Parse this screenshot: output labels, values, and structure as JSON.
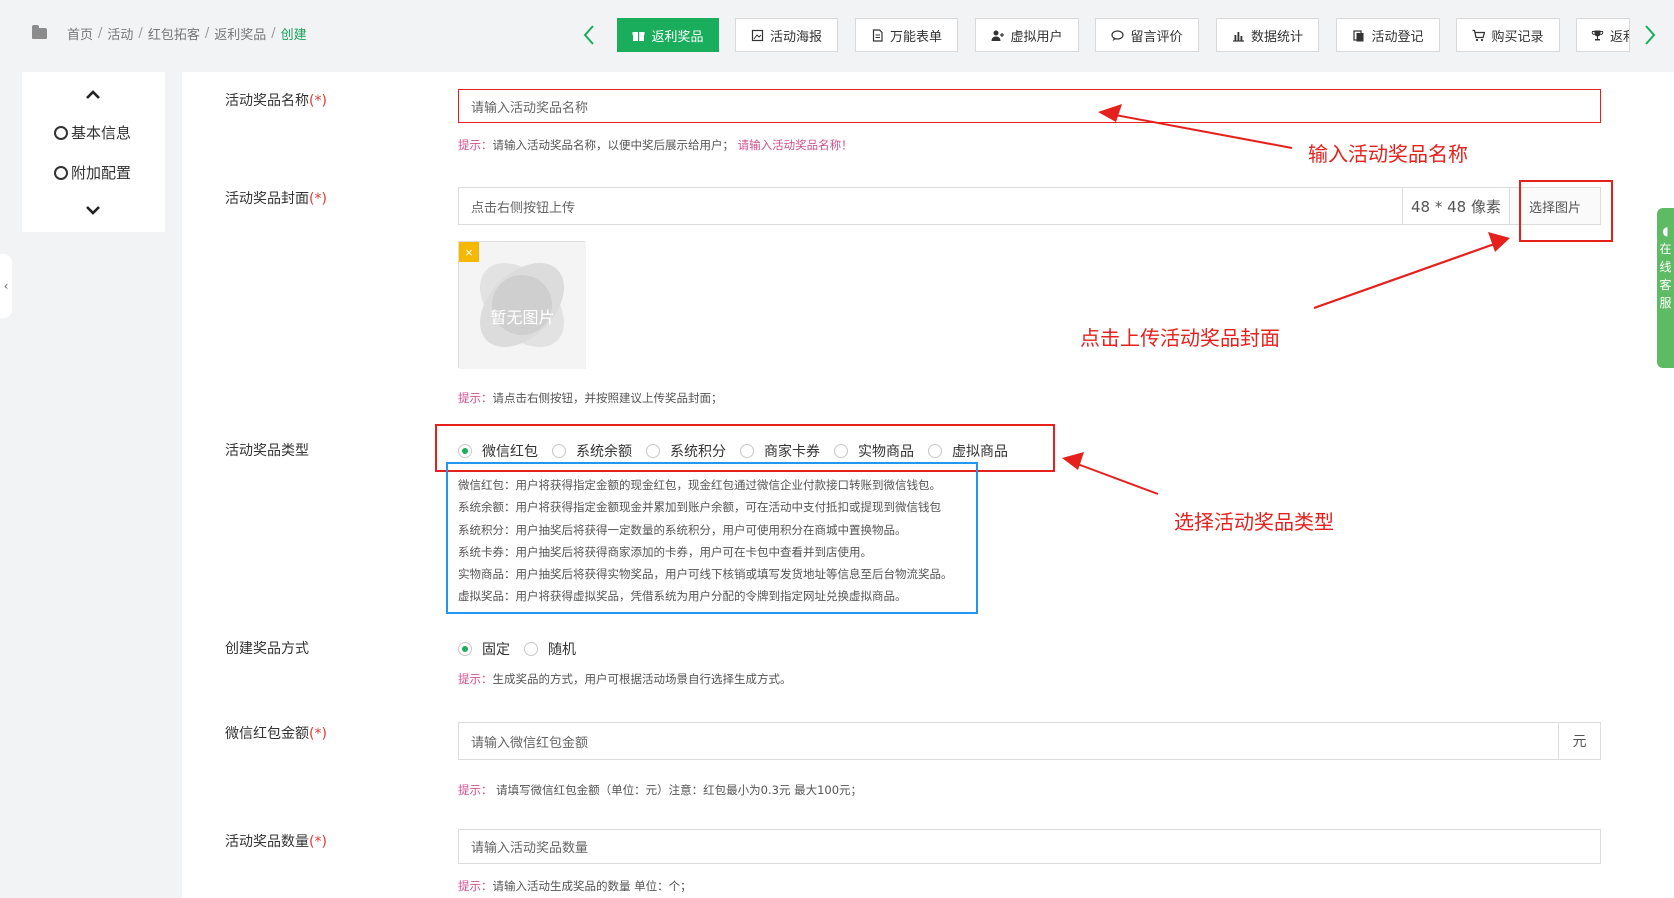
{
  "breadcrumb": {
    "items": [
      "首页",
      "活动",
      "红包拓客",
      "返利奖品"
    ],
    "current": "创建"
  },
  "tabs": [
    {
      "label": "返利奖品",
      "icon": "gift-icon",
      "active": true
    },
    {
      "label": "活动海报",
      "icon": "image-icon"
    },
    {
      "label": "万能表单",
      "icon": "file-icon"
    },
    {
      "label": "虚拟用户",
      "icon": "user-plus-icon"
    },
    {
      "label": "留言评价",
      "icon": "comment-icon"
    },
    {
      "label": "数据统计",
      "icon": "bar-chart-icon"
    },
    {
      "label": "活动登记",
      "icon": "clipboard-icon"
    },
    {
      "label": "购买记录",
      "icon": "cart-icon"
    },
    {
      "label": "返利",
      "icon": "trophy-icon"
    }
  ],
  "side_nav": {
    "items": [
      "基本信息",
      "附加配置"
    ]
  },
  "form": {
    "name": {
      "label": "活动奖品名称",
      "required_mark": "(*)",
      "placeholder": "请输入活动奖品名称",
      "tip_key": "提示：",
      "tip": "请输入活动奖品名称，以便中奖后展示给用户；",
      "error": "请输入活动奖品名称！"
    },
    "cover": {
      "label": "活动奖品封面",
      "required_mark": "(*)",
      "placeholder": "点击右侧按钮上传",
      "size": "48 * 48 像素",
      "button": "选择图片",
      "no_image": "暂无图片",
      "remove": "×",
      "tip_key": "提示：",
      "tip": "请点击右侧按钮，并按照建议上传奖品封面；"
    },
    "type": {
      "label": "活动奖品类型",
      "options": [
        "微信红包",
        "系统余额",
        "系统积分",
        "商家卡券",
        "实物商品",
        "虚拟商品"
      ],
      "selected": "微信红包",
      "descriptions": [
        "微信红包：用户将获得指定金额的现金红包，现金红包通过微信企业付款接口转账到微信钱包。",
        "系统余额：用户将获得指定金额现金并累加到账户余额，可在活动中支付抵扣或提现到微信钱包",
        "系统积分：用户抽奖后将获得一定数量的系统积分，用户可使用积分在商城中置换物品。",
        "系统卡券：用户抽奖后将获得商家添加的卡券，用户可在卡包中查看并到店使用。",
        "实物商品：用户抽奖后将获得实物奖品，用户可线下核销或填写发货地址等信息至后台物流奖品。",
        "虚拟奖品：用户将获得虚拟奖品，凭借系统为用户分配的令牌到指定网址兑换虚拟商品。"
      ]
    },
    "method": {
      "label": "创建奖品方式",
      "options": [
        "固定",
        "随机"
      ],
      "selected": "固定",
      "tip_key": "提示：",
      "tip": "生成奖品的方式，用户可根据活动场景自行选择生成方式。"
    },
    "amount": {
      "label": "微信红包金额",
      "required_mark": "(*)",
      "placeholder": "请输入微信红包金额",
      "unit": "元",
      "tip_key": "提示：",
      "tip": "请填写微信红包金额（单位：元）注意：红包最小为0.3元 最大100元；"
    },
    "quantity": {
      "label": "活动奖品数量",
      "required_mark": "(*)",
      "placeholder": "请输入活动奖品数量",
      "tip_key": "提示：",
      "tip": "请输入活动生成奖品的数量 单位：个；"
    }
  },
  "annotations": {
    "name": "输入活动奖品名称",
    "cover": "点击上传活动奖品封面",
    "type": "选择活动奖品类型"
  },
  "side_widget": {
    "text": "在线客服"
  },
  "colors": {
    "accent": "#1aad5c",
    "annotation": "#e6211d",
    "highlight_blue": "#2196f3"
  }
}
